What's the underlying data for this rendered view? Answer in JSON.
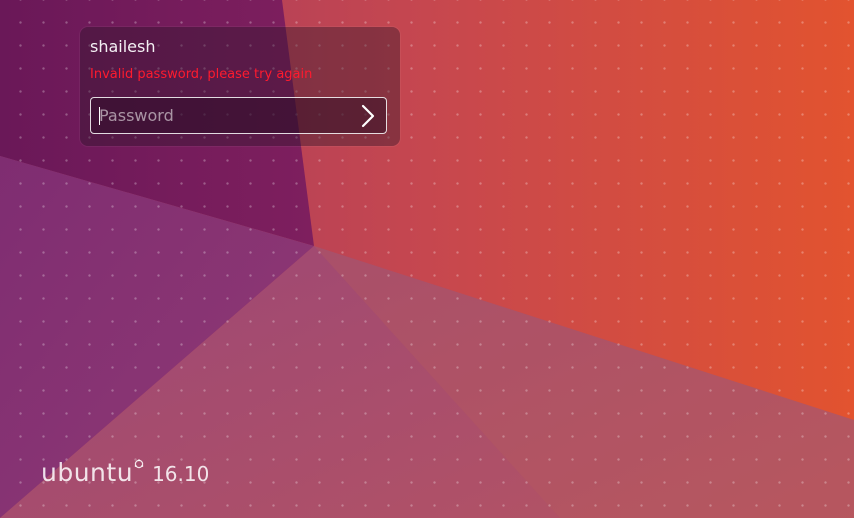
{
  "login": {
    "username": "shailesh",
    "error_message": "Invalid password, please try again",
    "password_placeholder": "Password",
    "password_value": ""
  },
  "icons": {
    "submit": "chevron-right-icon",
    "logo_mark": "ubuntu-circle-of-friends-icon"
  },
  "branding": {
    "wordmark": "ubuntu",
    "version": "16.10"
  },
  "colors": {
    "error_text": "#ff1a2e",
    "wallpaper_purple": "#6e1a5c",
    "wallpaper_orange": "#e3502f"
  }
}
